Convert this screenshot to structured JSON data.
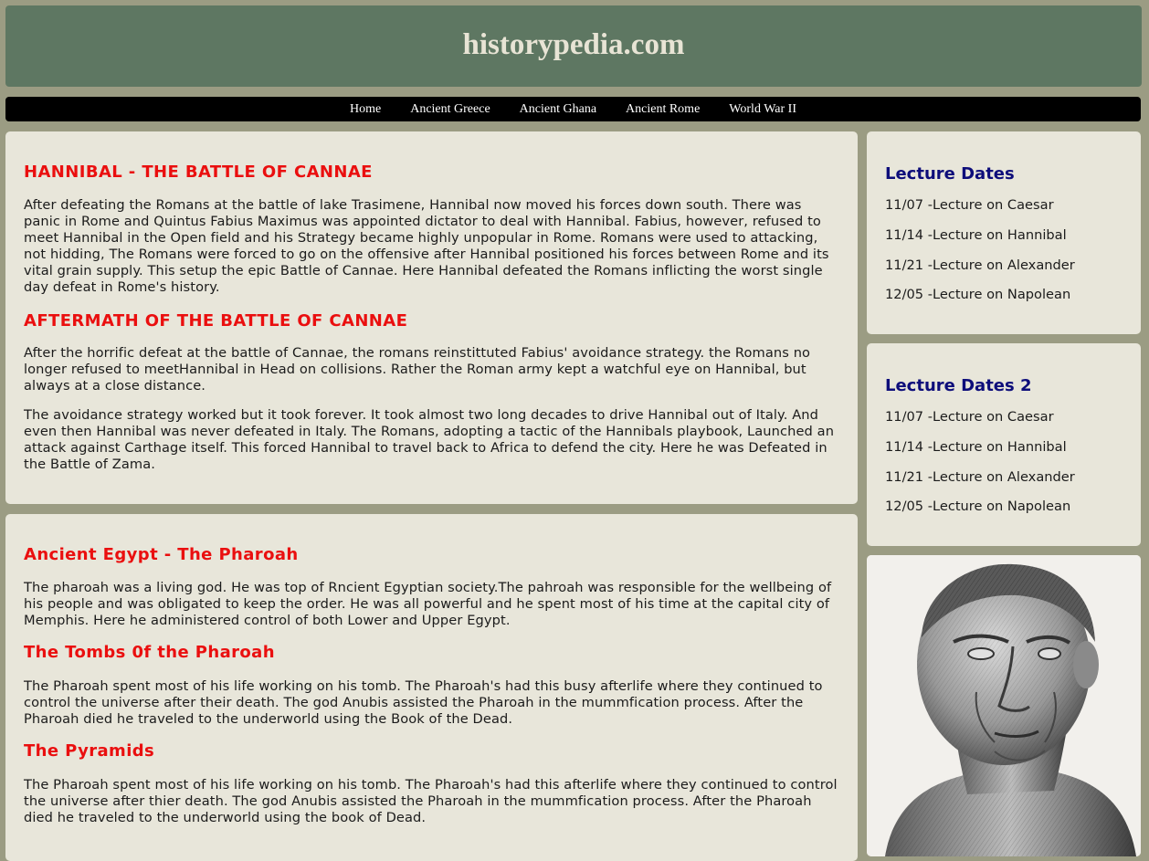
{
  "site": {
    "title": "historypedia.com"
  },
  "nav": {
    "items": [
      "Home",
      "Ancient Greece",
      "Ancient Ghana",
      "Ancient Rome",
      "World War II"
    ]
  },
  "hannibal": {
    "heading1": "HANNIBAL - THE BATTLE OF CANNAE",
    "para1": "After defeating the Romans at the battle of lake Trasimene, Hannibal now moved his forces down south. There was panic in Rome and Quintus Fabius Maximus was appointed dictator to deal with Hannibal. Fabius, however, refused to meet Hannibal in the Open field and his Strategy became highly unpopular in Rome. Romans were used to attacking, not hidding, The Romans were forced to go on the offensive after Hannibal positioned his forces between Rome and its vital grain supply. This setup the epic Battle of Cannae. Here Hannibal defeated the Romans inflicting the worst single day defeat in Rome's history.",
    "heading2": "AFTERMATH OF THE BATTLE OF CANNAE",
    "para2": "After the horrific defeat at the battle of Cannae, the romans reinstittuted Fabius' avoidance strategy. the Romans no longer refused to meetHannibal in Head on collisions. Rather the Roman army kept a watchful eye on Hannibal, but always at a close distance.",
    "para3": "The avoidance strategy worked but it took forever. It took almost two long decades to drive Hannibal out of Italy. And even then Hannibal was never defeated in Italy. The Romans, adopting a tactic of the Hannibals playbook, Launched an attack against Carthage itself. This forced Hannibal to travel back to Africa to defend the city. Here he was Defeated in the Battle of Zama."
  },
  "egypt": {
    "heading1": "Ancient Egypt - The Pharoah",
    "para1": "The pharoah was a living god. He was top of Rncient Egyptian society.The pahroah was responsible for the wellbeing of his people and was obligated to keep the order. He was all powerful and he spent most of his time at the capital city of Memphis. Here he administered control of both Lower and Upper Egypt.",
    "heading2": "The Tombs 0f the Pharoah",
    "para2": "The Pharoah spent most of his life working on his tomb. The Pharoah's had this busy afterlife where they continued to control the universe after their death. The god Anubis assisted the Pharoah in the mummfication process. After the Pharoah died he traveled to the underworld using the Book of the Dead.",
    "heading3": "The Pyramids",
    "para3": "The Pharoah spent most of his life working on his tomb. The Pharoah's had this afterlife where they continued to control the universe after thier death. The god Anubis assisted the Pharoah in the mummfication process. After the Pharoah died he traveled to the underworld using the book of Dead."
  },
  "lectures1": {
    "title": "Lecture Dates",
    "items": [
      "11/07 -Lecture on Caesar",
      "11/14 -Lecture on Hannibal",
      "11/21 -Lecture on Alexander",
      "12/05 -Lecture on Napolean"
    ]
  },
  "lectures2": {
    "title": "Lecture Dates 2",
    "items": [
      "11/07 -Lecture on Caesar",
      "11/14 -Lecture on Hannibal",
      "11/21 -Lecture on Alexander",
      "12/05 -Lecture on Napolean"
    ]
  },
  "image": {
    "subject": "marble bust of Julius Caesar"
  },
  "colors": {
    "page_bg": "#9b9c83",
    "header_bg": "#5e7762",
    "card_bg": "#e8e6da",
    "heading_red": "#ea0f0f",
    "heading_blue": "#0d0d7a"
  }
}
